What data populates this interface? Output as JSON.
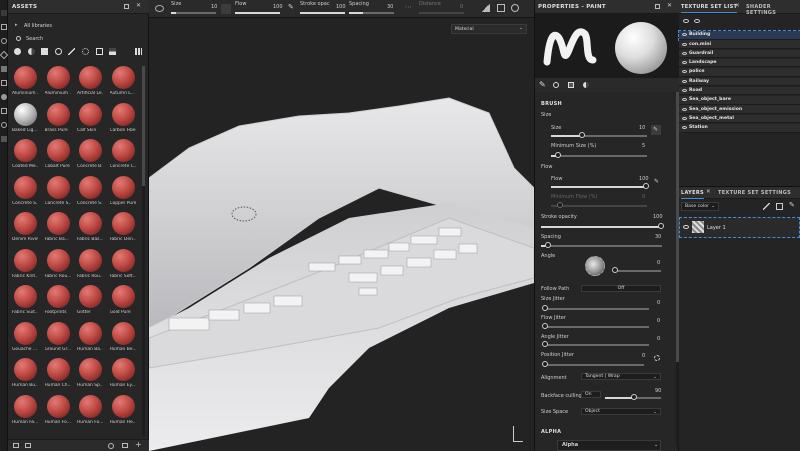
{
  "toolbar": {
    "size_label": "Size",
    "size_value": "10",
    "flow_label": "Flow",
    "flow_value": "100",
    "stroke_label": "Stroke opac",
    "stroke_value": "100",
    "spacing_label": "Spacing",
    "spacing_value": "30",
    "distance_label": "Distance",
    "distance_value": "0",
    "material_mode": "Material"
  },
  "assets": {
    "title": "ASSETS",
    "library": "All libraries",
    "search_placeholder": "Search",
    "items": [
      "Aluminium ...",
      "Aluminium ...",
      "Artificial Le...",
      "Autumn L...",
      "Baked Lig...",
      "Brass Pure",
      "Calf Skin",
      "Carbon Fiber",
      "Coated Me...",
      "Cobalt Pure",
      "Concrete B...",
      "Concrete C...",
      "Concrete S...",
      "Concrete S...",
      "Concrete S...",
      "Copper Pure",
      "Denim Rivet",
      "Fabric Ba...",
      "Fabric Bas...",
      "Fabric Den...",
      "Fabric Knit...",
      "Fabric Rou...",
      "Fabric Rou...",
      "Fabric Soft...",
      "Fabric Suit...",
      "Footprints",
      "Glitter",
      "Gold Pure",
      "Gouache ...",
      "Ground Gr...",
      "Human Ba...",
      "Human Be...",
      "Human Bu...",
      "Human Ch...",
      "Human Sp...",
      "Human Ey...",
      "Human Fa...",
      "Human Fo...",
      "Human Fo...",
      "Human He..."
    ]
  },
  "properties": {
    "title": "PROPERTIES - PAINT",
    "brush_section": "BRUSH",
    "size_group": "Size",
    "size_label": "Size",
    "size_value": "10",
    "min_size_label": "Minimum Size (%)",
    "min_size_value": "5",
    "flow_group": "Flow",
    "flow_label": "Flow",
    "flow_value": "100",
    "min_flow_label": "Minimum Flow (%)",
    "min_flow_value": "0",
    "stroke_label": "Stroke opacity",
    "stroke_value": "100",
    "spacing_label": "Spacing",
    "spacing_value": "30",
    "angle_label": "Angle",
    "angle_value": "0",
    "follow_label": "Follow Path",
    "follow_value": "Off",
    "size_jitter_label": "Size Jitter",
    "size_jitter_value": "0",
    "flow_jitter_label": "Flow Jitter",
    "flow_jitter_value": "0",
    "angle_jitter_label": "Angle Jitter",
    "angle_jitter_value": "0",
    "pos_jitter_label": "Position Jitter",
    "pos_jitter_value": "0",
    "alignment_label": "Alignment",
    "alignment_value": "Tangent | Wrap",
    "backface_label": "Backface culling",
    "backface_value": "On",
    "backface_number": "90",
    "sizespace_label": "Size Space",
    "sizespace_value": "Object",
    "alpha_section": "ALPHA",
    "alpha_name": "Alpha"
  },
  "texture_set": {
    "tab_list": "TEXTURE SET LIST",
    "tab_shader": "SHADER SETTINGS",
    "items": [
      "Building",
      "con.mini",
      "Guardrail",
      "Landscape",
      "police",
      "Railway",
      "Road",
      "Sea_object_bare",
      "Sea_object_emission",
      "Sea_object_metal",
      "Station"
    ]
  },
  "layers": {
    "tab_layers": "LAYERS",
    "tab_settings": "TEXTURE SET SETTINGS",
    "channel": "Base color",
    "layer_name": "Layer 1"
  },
  "colors": {
    "accent": "#3f8fd8",
    "highlight": "#2b3a55"
  }
}
